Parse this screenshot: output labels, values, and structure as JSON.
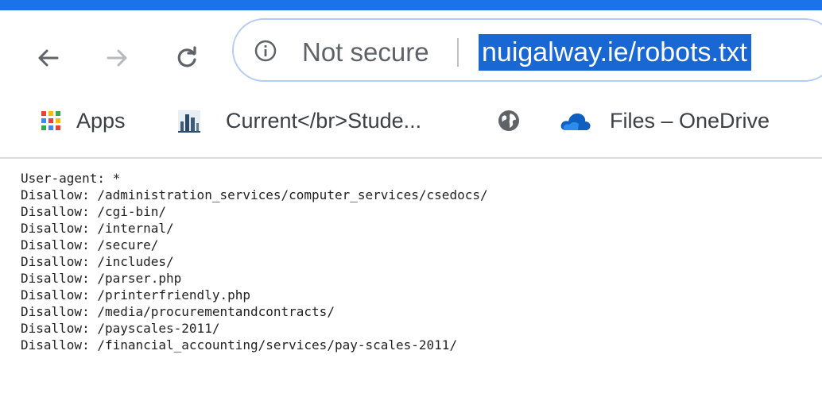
{
  "colors": {
    "accent": "#1a73e8",
    "url_highlight": "#1967d2"
  },
  "toolbar": {
    "back_icon": "arrow-left-icon",
    "forward_icon": "arrow-right-icon",
    "reload_icon": "reload-icon",
    "security_label": "Not secure",
    "url": "nuigalway.ie/robots.txt"
  },
  "bookmarks": [
    {
      "label": "Apps",
      "icon": "apps-grid-icon"
    },
    {
      "label": "Current</br>Stude...",
      "icon": "building-icon"
    },
    {
      "label": "",
      "icon": "globe-icon"
    },
    {
      "label": "Files – OneDrive",
      "icon": "cloud-icon"
    }
  ],
  "robots_lines": [
    "User-agent: *",
    "Disallow: /administration_services/computer_services/csedocs/",
    "Disallow: /cgi-bin/",
    "Disallow: /internal/",
    "Disallow: /secure/",
    "Disallow: /includes/",
    "Disallow: /parser.php",
    "Disallow: /printerfriendly.php",
    "Disallow: /media/procurementandcontracts/",
    "Disallow: /payscales-2011/",
    "Disallow: /financial_accounting/services/pay-scales-2011/"
  ]
}
